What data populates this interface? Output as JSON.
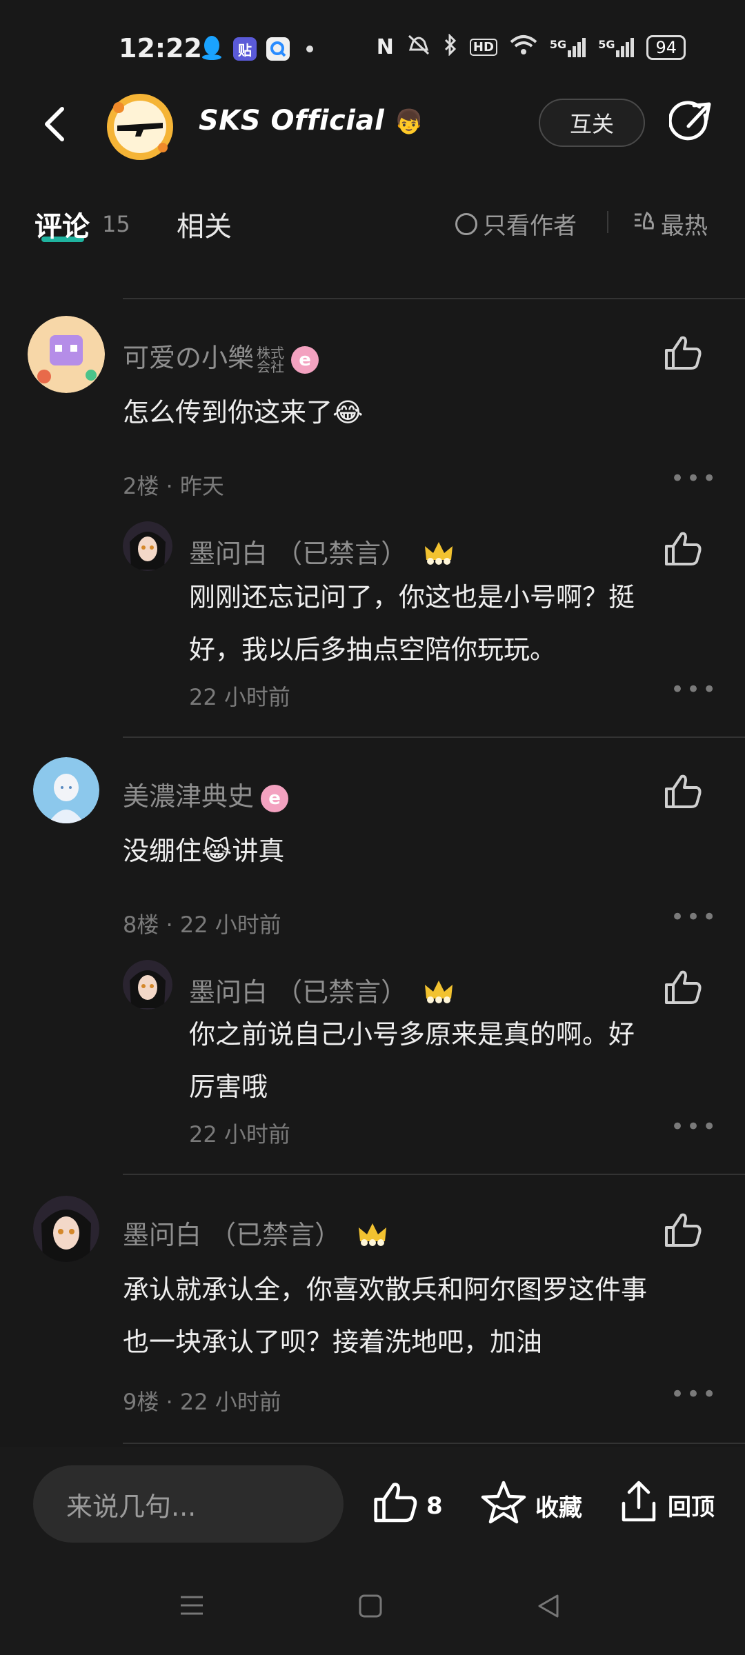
{
  "status_bar": {
    "time": "12:22",
    "battery": "94",
    "network_1": "5G",
    "network_2": "5G",
    "hd_label": "HD",
    "app_icons": [
      "qq-icon",
      "tieba-icon",
      "browser-icon"
    ]
  },
  "header": {
    "title": "SKS Official",
    "follow_label": "互关"
  },
  "tabs": {
    "comments_label": "评论",
    "comments_count": "15",
    "related_label": "相关",
    "author_only_label": "只看作者",
    "sort_label": "最热"
  },
  "comments": [
    {
      "username": "可爱の小樂",
      "suffix_top": "株式",
      "suffix_bottom": "会社",
      "text": "怎么传到你这来了😂",
      "meta": "2楼 · 昨天",
      "reply": {
        "username": "墨问白 （已禁言）",
        "text_line1": "刚刚还忘记问了，你这也是小号啊？挺",
        "text_line2": "好，我以后多抽点空陪你玩玩。",
        "meta": "22 小时前"
      }
    },
    {
      "username": "美濃津典史",
      "text": "没绷住😹讲真",
      "meta": "8楼 · 22 小时前",
      "reply": {
        "username": "墨问白 （已禁言）",
        "text_line1": "你之前说自己小号多原来是真的啊。好",
        "text_line2": "厉害哦",
        "meta": "22 小时前"
      }
    },
    {
      "username": "墨问白 （已禁言）",
      "text_line1": "承认就承认全，你喜欢散兵和阿尔图罗这件事",
      "text_line2": "也一块承认了呗？接着洗地吧，加油",
      "meta": "9楼 · 22 小时前"
    }
  ],
  "bottom": {
    "input_placeholder": "来说几句...",
    "like_count": "8",
    "favorite_label": "收藏",
    "top_label": "回顶"
  },
  "colors": {
    "background": "#181818",
    "accent": "#1fb39f",
    "badge_pink": "#f3a2c0"
  }
}
